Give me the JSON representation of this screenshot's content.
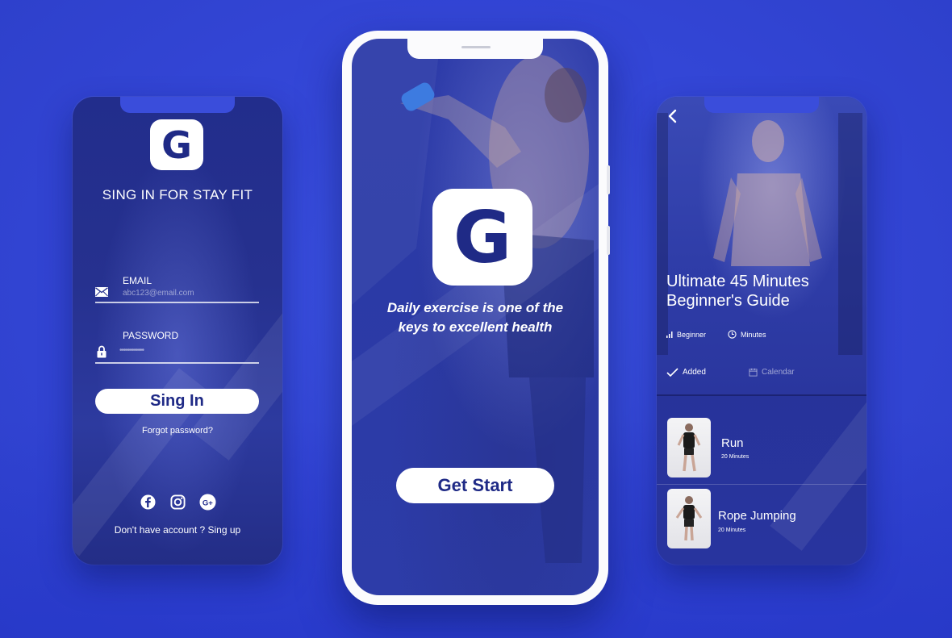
{
  "signin": {
    "logo_letter": "G",
    "title": "SING IN FOR STAY FIT",
    "email_label": "EMAIL",
    "email_value": "abc123@email.com",
    "password_label": "PASSWORD",
    "password_value": "••••••••••••",
    "signin_button": "Sing In",
    "forgot": "Forgot password?",
    "social_icons": [
      "facebook-icon",
      "instagram-icon",
      "google-plus-icon"
    ],
    "signup": "Don't have account ? Sing up"
  },
  "welcome": {
    "logo_letter": "G",
    "tagline_line1": "Daily exercise is one of the",
    "tagline_line2": "keys to excellent health",
    "start_button": "Get Start"
  },
  "workout": {
    "title_line1": "Ultimate 45 Minutes",
    "title_line2": "Beginner's Guide",
    "level": "Beginner",
    "duration": "Minutes",
    "added": "Added",
    "calendar": "Calendar",
    "exercises": [
      {
        "name": "Run",
        "duration": "20 Minutes"
      },
      {
        "name": "Rope Jumping",
        "duration": "20 Minutes"
      }
    ]
  },
  "colors": {
    "background": "#3447d8",
    "screen": "#26318f",
    "accent_text": "#1f2a86",
    "white": "#ffffff"
  }
}
